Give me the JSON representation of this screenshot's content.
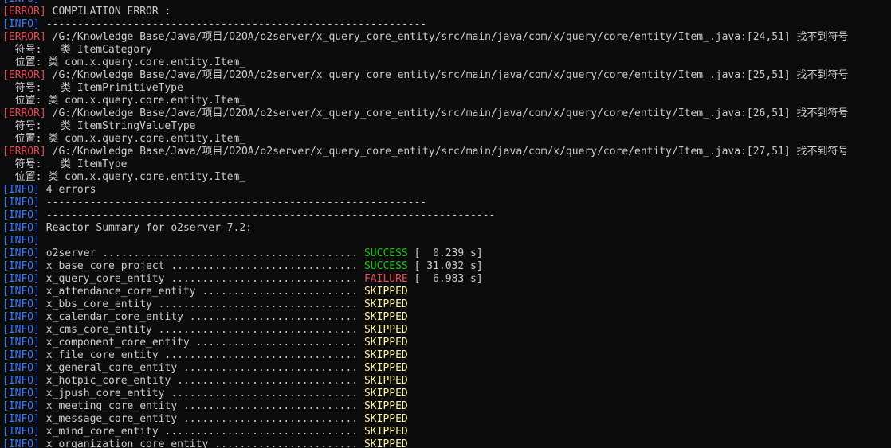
{
  "terminal": {
    "lines": [
      {
        "level": "[INFO]",
        "text": ""
      },
      {
        "level": "[ERROR]",
        "text": " COMPILATION ERROR :"
      },
      {
        "level": "[INFO]",
        "text": " -------------------------------------------------------------"
      },
      {
        "level": "[ERROR]",
        "text": " /G:/Knowledge Base/Java/项目/O2OA/o2server/x_query_core_entity/src/main/java/com/x/query/core/entity/Item_.java:[24,51] 找不到符号"
      },
      {
        "level": "",
        "text": "  符号:   类 ItemCategory"
      },
      {
        "level": "",
        "text": "  位置: 类 com.x.query.core.entity.Item_"
      },
      {
        "level": "[ERROR]",
        "text": " /G:/Knowledge Base/Java/项目/O2OA/o2server/x_query_core_entity/src/main/java/com/x/query/core/entity/Item_.java:[25,51] 找不到符号"
      },
      {
        "level": "",
        "text": "  符号:   类 ItemPrimitiveType"
      },
      {
        "level": "",
        "text": "  位置: 类 com.x.query.core.entity.Item_"
      },
      {
        "level": "[ERROR]",
        "text": " /G:/Knowledge Base/Java/项目/O2OA/o2server/x_query_core_entity/src/main/java/com/x/query/core/entity/Item_.java:[26,51] 找不到符号"
      },
      {
        "level": "",
        "text": "  符号:   类 ItemStringValueType"
      },
      {
        "level": "",
        "text": "  位置: 类 com.x.query.core.entity.Item_"
      },
      {
        "level": "[ERROR]",
        "text": " /G:/Knowledge Base/Java/项目/O2OA/o2server/x_query_core_entity/src/main/java/com/x/query/core/entity/Item_.java:[27,51] 找不到符号"
      },
      {
        "level": "",
        "text": "  符号:   类 ItemType"
      },
      {
        "level": "",
        "text": "  位置: 类 com.x.query.core.entity.Item_"
      },
      {
        "level": "[INFO]",
        "text": " 4 errors"
      },
      {
        "level": "[INFO]",
        "text": " -------------------------------------------------------------"
      },
      {
        "level": "[INFO]",
        "text": " ------------------------------------------------------------------------"
      },
      {
        "level": "[INFO]",
        "text": " Reactor Summary for o2server 7.2:"
      },
      {
        "level": "[INFO]",
        "text": ""
      },
      {
        "level": "[INFO]",
        "text": " o2server ......................................... ",
        "status": "SUCCESS",
        "time": " [  0.239 s]"
      },
      {
        "level": "[INFO]",
        "text": " x_base_core_project .............................. ",
        "status": "SUCCESS",
        "time": " [ 31.032 s]"
      },
      {
        "level": "[INFO]",
        "text": " x_query_core_entity .............................. ",
        "status": "FAILURE",
        "time": " [  6.983 s]"
      },
      {
        "level": "[INFO]",
        "text": " x_attendance_core_entity ......................... ",
        "status": "SKIPPED",
        "time": ""
      },
      {
        "level": "[INFO]",
        "text": " x_bbs_core_entity ................................ ",
        "status": "SKIPPED",
        "time": ""
      },
      {
        "level": "[INFO]",
        "text": " x_calendar_core_entity ........................... ",
        "status": "SKIPPED",
        "time": ""
      },
      {
        "level": "[INFO]",
        "text": " x_cms_core_entity ................................ ",
        "status": "SKIPPED",
        "time": ""
      },
      {
        "level": "[INFO]",
        "text": " x_component_core_entity .......................... ",
        "status": "SKIPPED",
        "time": ""
      },
      {
        "level": "[INFO]",
        "text": " x_file_core_entity ............................... ",
        "status": "SKIPPED",
        "time": ""
      },
      {
        "level": "[INFO]",
        "text": " x_general_core_entity ............................ ",
        "status": "SKIPPED",
        "time": ""
      },
      {
        "level": "[INFO]",
        "text": " x_hotpic_core_entity ............................. ",
        "status": "SKIPPED",
        "time": ""
      },
      {
        "level": "[INFO]",
        "text": " x_jpush_core_entity .............................. ",
        "status": "SKIPPED",
        "time": ""
      },
      {
        "level": "[INFO]",
        "text": " x_meeting_core_entity ............................ ",
        "status": "SKIPPED",
        "time": ""
      },
      {
        "level": "[INFO]",
        "text": " x_message_core_entity ............................ ",
        "status": "SKIPPED",
        "time": ""
      },
      {
        "level": "[INFO]",
        "text": " x_mind_core_entity ............................... ",
        "status": "SKIPPED",
        "time": ""
      },
      {
        "level": "[INFO]",
        "text": " x_organization_core_entity ....................... ",
        "status": "SKIPPED",
        "time": ""
      }
    ]
  },
  "colors": {
    "background": "#0c0c0c",
    "foreground": "#cccccc",
    "info": "#3b78ff",
    "error": "#e74856",
    "success": "#16c60c",
    "failure": "#e74856",
    "skipped": "#f9f1a5"
  }
}
